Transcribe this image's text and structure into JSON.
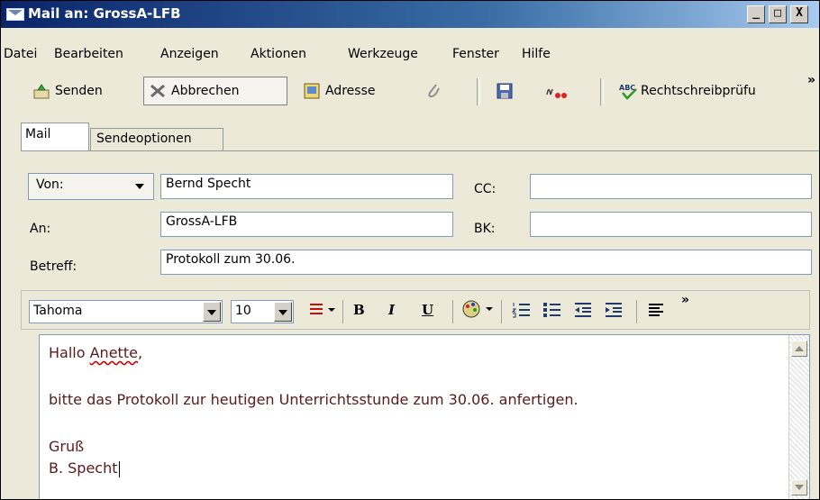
{
  "window": {
    "title": "Mail an: GrossA-LFB",
    "controls": {
      "minimize": "_",
      "maximize": "□",
      "close": "X"
    }
  },
  "menu": [
    "Datei",
    "Bearbeiten",
    "Anzeigen",
    "Aktionen",
    "Werkzeuge",
    "Fenster",
    "Hilfe"
  ],
  "toolbar": {
    "send_label": "Senden",
    "cancel_label": "Abbrechen",
    "address_label": "Adresse",
    "spellcheck_label": "Rechtschreibprüfu",
    "overflow": "»"
  },
  "tabs": {
    "mail": "Mail",
    "send_options": "Sendeoptionen"
  },
  "form": {
    "from_label": "Von:",
    "from_value": "Bernd Specht",
    "to_label": "An:",
    "to_value": "GrossA-LFB",
    "subject_label": "Betreff:",
    "subject_value": "Protokoll zum 30.06.",
    "cc_label": "CC:",
    "cc_value": "",
    "bcc_label": "BK:",
    "bcc_value": ""
  },
  "format": {
    "font": "Tahoma",
    "size": "10",
    "bold": "B",
    "italic": "I",
    "underline": "U",
    "overflow": "»"
  },
  "body": {
    "greeting_word": "Hallo ",
    "greeting_name": "Anette",
    "greeting_comma": ",",
    "line2": "bitte das Protokoll zur heutigen Unterrichtsstunde zum 30.06. anfertigen.",
    "line3": "Gruß",
    "line4": "B. Specht"
  },
  "colors": {
    "title_gradient_start": "#0a246a",
    "body_text": "#5a1a1a",
    "panel_bg": "#ece9d8"
  }
}
